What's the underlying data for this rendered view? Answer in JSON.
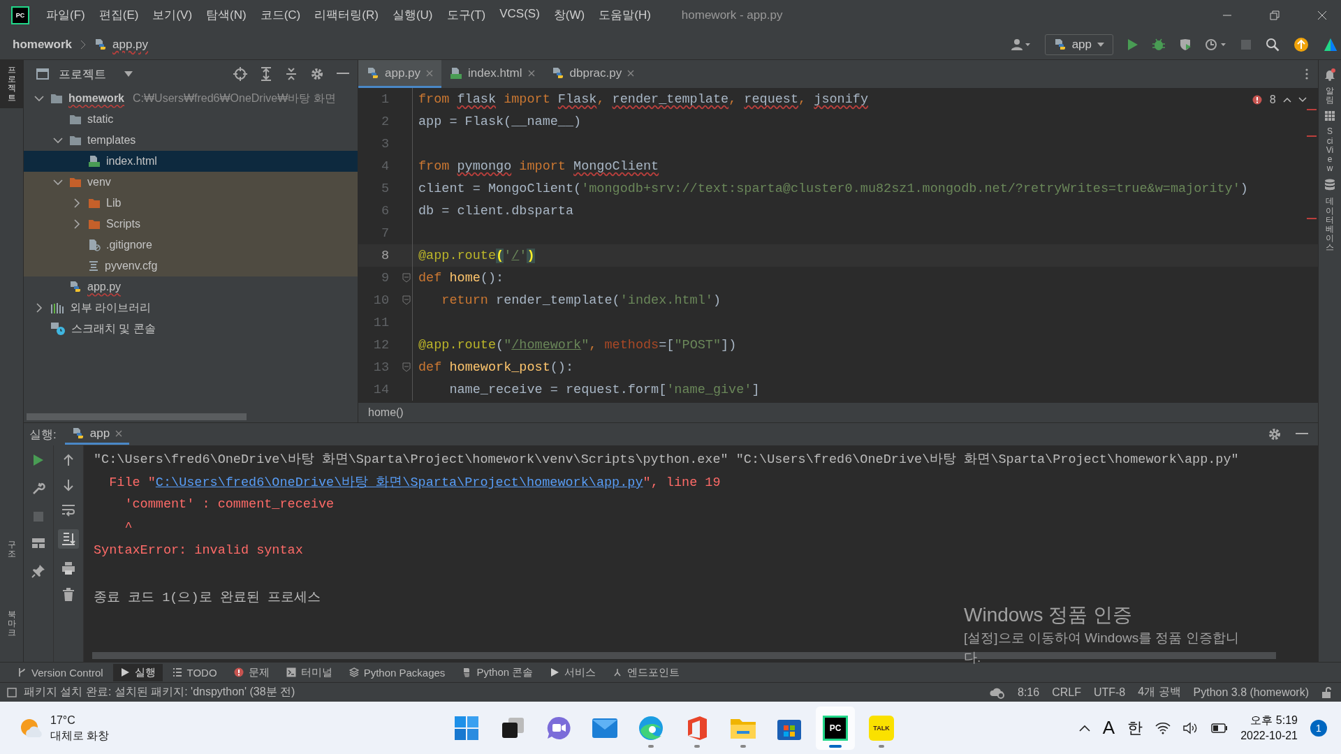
{
  "window": {
    "title": "homework - app.py",
    "logo_text": "PC"
  },
  "menu": [
    "파일(F)",
    "편집(E)",
    "보기(V)",
    "탐색(N)",
    "코드(C)",
    "리팩터링(R)",
    "실행(U)",
    "도구(T)",
    "VCS(S)",
    "창(W)",
    "도움말(H)"
  ],
  "breadcrumb": [
    {
      "label": "homework",
      "kind": "project"
    },
    {
      "label": "app.py",
      "kind": "python"
    }
  ],
  "run_config": {
    "label": "app"
  },
  "left_stripe": [
    {
      "label": "프로젝트",
      "selected": true
    },
    {
      "label": "구조",
      "selected": false
    },
    {
      "label": "북마크",
      "selected": false
    }
  ],
  "right_stripe": [
    {
      "label": "알림"
    },
    {
      "label": "SciView"
    },
    {
      "label": "데이터베이스"
    }
  ],
  "project_panel": {
    "title": "프로젝트",
    "tree": [
      {
        "label": "homework",
        "hint": "C:₩Users₩fred6₩OneDrive₩바탕 화면",
        "kind": "folder",
        "expanded": true,
        "selected": false,
        "excluded": false,
        "children": [
          {
            "label": "static",
            "kind": "folder",
            "selected": false,
            "excluded": false
          },
          {
            "label": "templates",
            "kind": "folder",
            "expanded": true,
            "selected": false,
            "excluded": false,
            "children": [
              {
                "label": "index.html",
                "kind": "html",
                "selected": true
              }
            ]
          },
          {
            "label": "venv",
            "kind": "folder",
            "expanded": true,
            "selected": false,
            "excluded": true,
            "children": [
              {
                "label": "Lib",
                "kind": "folder",
                "expanded": false,
                "selected": false
              },
              {
                "label": "Scripts",
                "kind": "folder",
                "expanded": false,
                "selected": false
              },
              {
                "label": ".gitignore",
                "kind": "gitignore",
                "selected": false
              },
              {
                "label": "pyvenv.cfg",
                "kind": "config",
                "selected": false
              }
            ]
          },
          {
            "label": "app.py",
            "kind": "python",
            "selected": false,
            "excluded": false
          }
        ]
      },
      {
        "label": "외부 라이브러리",
        "kind": "library",
        "expanded": false,
        "selected": false,
        "excluded": false
      },
      {
        "label": "스크래치 및 콘솔",
        "kind": "scratch",
        "selected": false,
        "excluded": false
      }
    ]
  },
  "editor": {
    "tabs": [
      {
        "label": "app.py",
        "kind": "python",
        "selected": true
      },
      {
        "label": "index.html",
        "kind": "html",
        "selected": false
      },
      {
        "label": "dbprac.py",
        "kind": "python",
        "selected": false
      }
    ],
    "error_count": "8",
    "lines": [
      {
        "number": "1",
        "current": false,
        "tokens": [
          {
            "text": "from ",
            "kind": "keyword"
          },
          {
            "text": "flask",
            "kind": "plain",
            "error": true
          },
          {
            "text": " import ",
            "kind": "keyword"
          },
          {
            "text": "Flask",
            "kind": "plain",
            "error": true
          },
          {
            "text": ", ",
            "kind": "keyword"
          },
          {
            "text": "render_template",
            "kind": "plain",
            "error": true
          },
          {
            "text": ", ",
            "kind": "keyword"
          },
          {
            "text": "request",
            "kind": "plain",
            "error": true
          },
          {
            "text": ", ",
            "kind": "keyword"
          },
          {
            "text": "jsonify",
            "kind": "plain",
            "error": true
          }
        ]
      },
      {
        "number": "2",
        "current": false,
        "tokens": [
          {
            "text": "app = Flask(__name__)",
            "kind": "plain"
          }
        ]
      },
      {
        "number": "3",
        "current": false
      },
      {
        "number": "4",
        "current": false,
        "tokens": [
          {
            "text": "from ",
            "kind": "keyword"
          },
          {
            "text": "pymongo",
            "kind": "plain",
            "error": true
          },
          {
            "text": " import ",
            "kind": "keyword"
          },
          {
            "text": "MongoClient",
            "kind": "plain",
            "error": true
          }
        ]
      },
      {
        "number": "5",
        "current": false,
        "tokens": [
          {
            "text": "client = MongoClient(",
            "kind": "plain"
          },
          {
            "text": "'mongodb+srv://text:sparta@cluster0.mu82sz1.mongodb.net/?retryWrites=true&w=majority'",
            "kind": "string"
          },
          {
            "text": ")",
            "kind": "plain"
          }
        ]
      },
      {
        "number": "6",
        "current": false,
        "tokens": [
          {
            "text": "db = client.dbsparta",
            "kind": "plain"
          }
        ]
      },
      {
        "number": "7",
        "current": false
      },
      {
        "number": "8",
        "current": true,
        "tokens": [
          {
            "text": "@app.route",
            "kind": "decorator"
          },
          {
            "text": "(",
            "kind": "brace"
          },
          {
            "text": "'",
            "kind": "string"
          },
          {
            "text": "/",
            "kind": "string-link"
          },
          {
            "text": "'",
            "kind": "string"
          },
          {
            "text": ")",
            "kind": "brace"
          }
        ]
      },
      {
        "number": "9",
        "current": false,
        "fold": true,
        "tokens": [
          {
            "text": "def ",
            "kind": "keyword"
          },
          {
            "text": "home",
            "kind": "function"
          },
          {
            "text": "():",
            "kind": "plain"
          }
        ]
      },
      {
        "number": "10",
        "current": false,
        "fold": true,
        "tokens": [
          {
            "text": "   return ",
            "kind": "keyword"
          },
          {
            "text": "render_template(",
            "kind": "plain"
          },
          {
            "text": "'index.html'",
            "kind": "string"
          },
          {
            "text": ")",
            "kind": "plain"
          }
        ]
      },
      {
        "number": "11",
        "current": false
      },
      {
        "number": "12",
        "current": false,
        "tokens": [
          {
            "text": "@app.route",
            "kind": "decorator"
          },
          {
            "text": "(",
            "kind": "plain"
          },
          {
            "text": "\"",
            "kind": "string"
          },
          {
            "text": "/homework",
            "kind": "string-link"
          },
          {
            "text": "\"",
            "kind": "string"
          },
          {
            "text": ", ",
            "kind": "keyword"
          },
          {
            "text": "methods",
            "kind": "param"
          },
          {
            "text": "=[",
            "kind": "plain"
          },
          {
            "text": "\"POST\"",
            "kind": "string"
          },
          {
            "text": "])",
            "kind": "plain"
          }
        ]
      },
      {
        "number": "13",
        "current": false,
        "fold": true,
        "tokens": [
          {
            "text": "def ",
            "kind": "keyword"
          },
          {
            "text": "homework_post",
            "kind": "function"
          },
          {
            "text": "():",
            "kind": "plain"
          }
        ]
      },
      {
        "number": "14",
        "current": false,
        "tokens": [
          {
            "text": "    name_receive = request.form[",
            "kind": "plain"
          },
          {
            "text": "'name_give'",
            "kind": "string"
          },
          {
            "text": "]",
            "kind": "plain"
          }
        ]
      }
    ],
    "scope": "home()"
  },
  "run_panel": {
    "label": "실행:",
    "tabs": [
      {
        "label": "app",
        "selected": true
      }
    ],
    "output": [
      {
        "kind": "command",
        "tokens": [
          {
            "text": "\"C:\\Users\\fred6\\OneDrive\\바탕 화면\\Sparta\\Project\\homework\\venv\\Scripts\\python.exe\" \"C:\\Users\\fred6\\OneDrive\\바탕 화면\\Sparta\\Project\\homework\\app.py\"",
            "kind": "text"
          }
        ]
      },
      {
        "kind": "error",
        "tokens": [
          {
            "text": "  File \"",
            "kind": "text"
          },
          {
            "text": "C:\\Users\\fred6\\OneDrive\\바탕 화면\\Sparta\\Project\\homework\\app.py",
            "kind": "link"
          },
          {
            "text": "\", line 19",
            "kind": "text"
          }
        ]
      },
      {
        "kind": "error",
        "tokens": [
          {
            "text": "    'comment' : comment_receive",
            "kind": "text"
          }
        ]
      },
      {
        "kind": "error",
        "tokens": [
          {
            "text": "    ^",
            "kind": "text"
          }
        ]
      },
      {
        "kind": "error",
        "tokens": [
          {
            "text": "SyntaxError: invalid syntax",
            "kind": "text"
          }
        ]
      },
      {
        "kind": "blank"
      },
      {
        "kind": "command",
        "tokens": [
          {
            "text": "종료 코드 1(으)로 완료된 프로세스",
            "kind": "text"
          }
        ]
      }
    ]
  },
  "tool_tabs": [
    {
      "label": "Version Control",
      "kind": "vcs",
      "selected": false
    },
    {
      "label": "실행",
      "kind": "run",
      "selected": true
    },
    {
      "label": "TODO",
      "kind": "list",
      "selected": false
    },
    {
      "label": "문제",
      "kind": "problem",
      "selected": false
    },
    {
      "label": "터미널",
      "kind": "terminal",
      "selected": false
    },
    {
      "label": "Python Packages",
      "kind": "packages",
      "selected": false
    },
    {
      "label": "Python 콘솔",
      "kind": "python",
      "selected": false
    },
    {
      "label": "서비스",
      "kind": "run",
      "selected": false
    },
    {
      "label": "엔드포인트",
      "kind": "endpoint",
      "selected": false
    }
  ],
  "status_bar": {
    "message": "패키지 설치 완료: 설치된 패키지: 'dnspython' (38분 전)",
    "items": [
      "8:16",
      "CRLF",
      "UTF-8",
      "4개 공백",
      "Python 3.8 (homework)"
    ]
  },
  "activation_notice": {
    "title": "Windows 정품 인증",
    "lines": [
      "[설정]으로 이동하여 Windows를 정품 인증합니",
      "다."
    ]
  },
  "taskbar": {
    "weather": {
      "temperature": "17°C",
      "description": "대체로 화창"
    },
    "apps": [
      {
        "kind": "start",
        "running": false,
        "active": false
      },
      {
        "kind": "taskview",
        "running": false,
        "active": false
      },
      {
        "kind": "chat",
        "running": false,
        "active": false
      },
      {
        "kind": "mail",
        "running": false,
        "active": false
      },
      {
        "kind": "edge",
        "running": true,
        "active": false
      },
      {
        "kind": "office",
        "running": true,
        "active": false
      },
      {
        "kind": "explorer",
        "running": true,
        "active": false
      },
      {
        "kind": "store",
        "running": false,
        "active": false
      },
      {
        "kind": "pycharm",
        "label": "PC",
        "running": true,
        "active": true
      },
      {
        "kind": "kakaotalk",
        "label": "TALK",
        "running": true,
        "active": false
      }
    ],
    "input_mode": "A",
    "ime": "한",
    "time": "오후 5:19",
    "date": "2022-10-21",
    "notifications": "1"
  }
}
